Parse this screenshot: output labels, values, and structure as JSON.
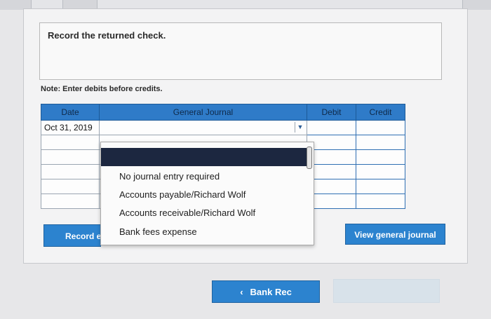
{
  "question": {
    "prompt": "Record the returned check.",
    "note": "Note: Enter debits before credits."
  },
  "journal": {
    "columns": [
      "Date",
      "General Journal",
      "Debit",
      "Credit"
    ],
    "rows": [
      {
        "date": "Oct 31, 2019",
        "account": "",
        "debit": "",
        "credit": ""
      },
      {
        "date": "",
        "account": "",
        "debit": "",
        "credit": ""
      },
      {
        "date": "",
        "account": "",
        "debit": "",
        "credit": ""
      },
      {
        "date": "",
        "account": "",
        "debit": "",
        "credit": ""
      },
      {
        "date": "",
        "account": "",
        "debit": "",
        "credit": ""
      },
      {
        "date": "",
        "account": "",
        "debit": "",
        "credit": ""
      }
    ]
  },
  "dropdown": {
    "options": [
      "No journal entry required",
      "Accounts payable/Richard Wolf",
      "Accounts receivable/Richard Wolf",
      "Bank fees expense"
    ]
  },
  "buttons": {
    "record_entry": "Record e",
    "view_general_journal": "View general journal",
    "bank_rec": "Bank Rec",
    "bank_rec_chevron": "‹"
  },
  "colors": {
    "header_blue": "#2f7bc8",
    "button_blue": "#2c83cf",
    "dropdown_highlight": "#1c2740"
  }
}
